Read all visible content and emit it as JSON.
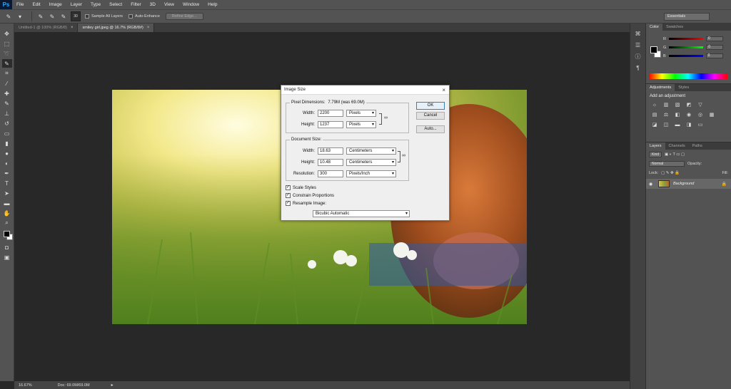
{
  "app": {
    "logo": "Ps"
  },
  "menu": [
    "File",
    "Edit",
    "Image",
    "Layer",
    "Type",
    "Select",
    "Filter",
    "3D",
    "View",
    "Window",
    "Help"
  ],
  "options": {
    "brush_size": "30",
    "sample_all_layers": "Sample All Layers",
    "auto_enhance": "Auto-Enhance",
    "refine_edge": "Refine Edge...",
    "workspace": "Essentials"
  },
  "tabs": [
    {
      "label": "Untitled-1 @ 100% (RGB/8)"
    },
    {
      "label": "smiley girl.jpeg @ 16.7% (RGB/8#)"
    }
  ],
  "status": {
    "zoom": "16.67%",
    "doc": "Doc: 69.0M/69.0M"
  },
  "panels": {
    "color_tab": "Color",
    "swatches_tab": "Swatches",
    "color_labels": [
      "R",
      "G",
      "B"
    ],
    "color_values": [
      "0",
      "0",
      "0"
    ],
    "adjustments_tab": "Adjustments",
    "styles_tab": "Styles",
    "add_adjustment": "Add an adjustment",
    "layers_tab": "Layers",
    "channels_tab": "Channels",
    "paths_tab": "Paths",
    "kind": "Kind",
    "blend_mode": "Normal",
    "opacity_label": "Opacity:",
    "lock_label": "Lock:",
    "fill_label": "Fill:",
    "layer_name": "Background"
  },
  "dialog": {
    "title": "Image Size",
    "pixel_dimensions": "Pixel Dimensions:",
    "pixel_size": "7.79M (was 69.0M)",
    "width_label": "Width:",
    "height_label": "Height:",
    "pixel_width": "2200",
    "pixel_height": "1237",
    "pixel_unit": "Pixels",
    "document_size": "Document Size:",
    "doc_width": "18.63",
    "doc_height": "10.48",
    "doc_unit": "Centimeters",
    "resolution_label": "Resolution:",
    "resolution": "300",
    "resolution_unit": "Pixels/Inch",
    "scale_styles": "Scale Styles",
    "constrain": "Constrain Proportions",
    "resample": "Resample Image:",
    "resample_method": "Bicubic Automatic",
    "ok": "OK",
    "cancel": "Cancel",
    "auto": "Auto..."
  }
}
